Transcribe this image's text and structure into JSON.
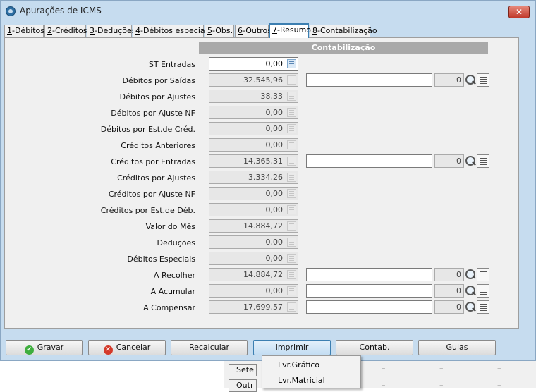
{
  "window": {
    "title": "Apurações de ICMS"
  },
  "tabs": [
    {
      "key": "1",
      "label": "-Débitos"
    },
    {
      "key": "2",
      "label": "-Créditos"
    },
    {
      "key": "3",
      "label": "-Deduções"
    },
    {
      "key": "4",
      "label": "-Débitos especiais"
    },
    {
      "key": "5",
      "label": "-Obs."
    },
    {
      "key": "6",
      "label": "-Outros"
    },
    {
      "key": "7",
      "label": "-Resumo"
    },
    {
      "key": "8",
      "label": "-Contabilização"
    }
  ],
  "section": {
    "contabilizacao": "Contabilização"
  },
  "rows": {
    "st_entradas": {
      "label": "ST Entradas",
      "value": "0,00"
    },
    "debitos_saidas": {
      "label": "Débitos por Saídas",
      "value": "32.545,96",
      "code": "0"
    },
    "debitos_ajustes": {
      "label": "Débitos por Ajustes",
      "value": "38,33"
    },
    "debitos_ajuste_nf": {
      "label": "Débitos por Ajuste NF",
      "value": "0,00"
    },
    "debitos_est_cred": {
      "label": "Débitos por Est.de Créd.",
      "value": "0,00"
    },
    "creditos_anteriores": {
      "label": "Créditos Anteriores",
      "value": "0,00"
    },
    "creditos_entradas": {
      "label": "Créditos por Entradas",
      "value": "14.365,31",
      "code": "0"
    },
    "creditos_ajustes": {
      "label": "Créditos por Ajustes",
      "value": "3.334,26"
    },
    "creditos_ajuste_nf": {
      "label": "Créditos por Ajuste NF",
      "value": "0,00"
    },
    "creditos_est_deb": {
      "label": "Créditos por Est.de Déb.",
      "value": "0,00"
    },
    "valor_mes": {
      "label": "Valor do Mês",
      "value": "14.884,72"
    },
    "deducoes": {
      "label": "Deduções",
      "value": "0,00"
    },
    "debitos_especiais": {
      "label": "Débitos Especiais",
      "value": "0,00"
    },
    "a_recolher": {
      "label": "A Recolher",
      "value": "14.884,72",
      "code": "0"
    },
    "a_acumular": {
      "label": "A Acumular",
      "value": "0,00",
      "code": "0"
    },
    "a_compensar": {
      "label": "A Compensar",
      "value": "17.699,57",
      "code": "0"
    }
  },
  "buttons": {
    "gravar": "Gravar",
    "cancelar": "Cancelar",
    "recalcular": "Recalcular",
    "imprimir": "Imprimir",
    "contab": "Contab.",
    "guias": "Guias"
  },
  "print_menu": {
    "grafico": "Lvr.Gráfico",
    "matricial": "Lvr.Matricial"
  },
  "background": {
    "btn1": "Sete",
    "btn2": "Outr",
    "dash": "–"
  }
}
